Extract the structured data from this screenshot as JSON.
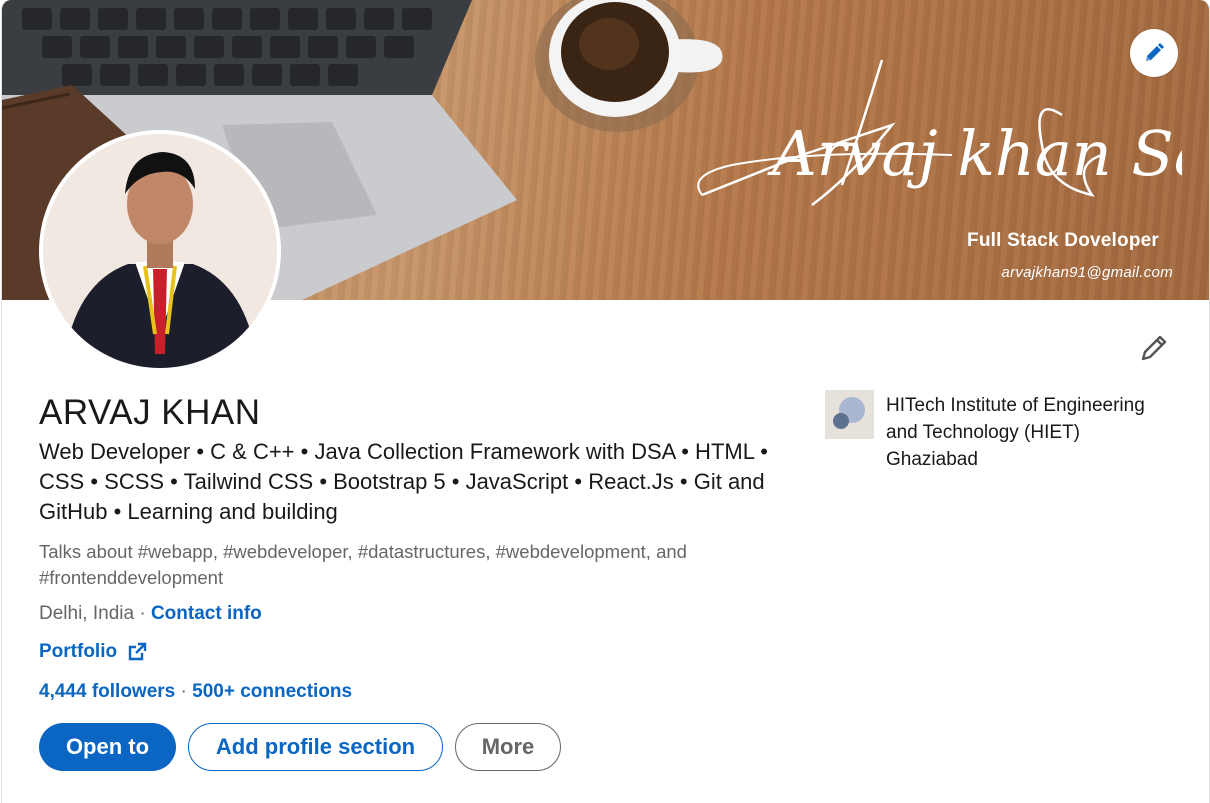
{
  "banner": {
    "signature": "Arvaj khan Saifi",
    "subtitle": "Full Stack Doveloper",
    "email": "arvajkhan91@gmail.com",
    "edit_icon": "pencil-icon"
  },
  "profile": {
    "name": "ARVAJ KHAN",
    "headline": "Web Developer • C & C++ • Java Collection Framework with DSA • HTML • CSS • SCSS • Tailwind CSS • Bootstrap 5 • JavaScript • React.Js • Git and GitHub • Learning and building",
    "talks_about": "Talks about #webapp, #webdeveloper, #datastructures, #webdevelopment, and #frontenddevelopment",
    "location": "Delhi, India",
    "separator": " · ",
    "contact_info": "Contact info",
    "portfolio": "Portfolio",
    "followers": "4,444 followers",
    "connections": "500+ connections"
  },
  "actions": {
    "open_to": "Open to",
    "add_section": "Add profile section",
    "more": "More"
  },
  "education": {
    "name": "HITech Institute of Engineering and Technology (HIET) Ghaziabad"
  },
  "colors": {
    "accent": "#0a66c2",
    "text_secondary": "#666666"
  }
}
